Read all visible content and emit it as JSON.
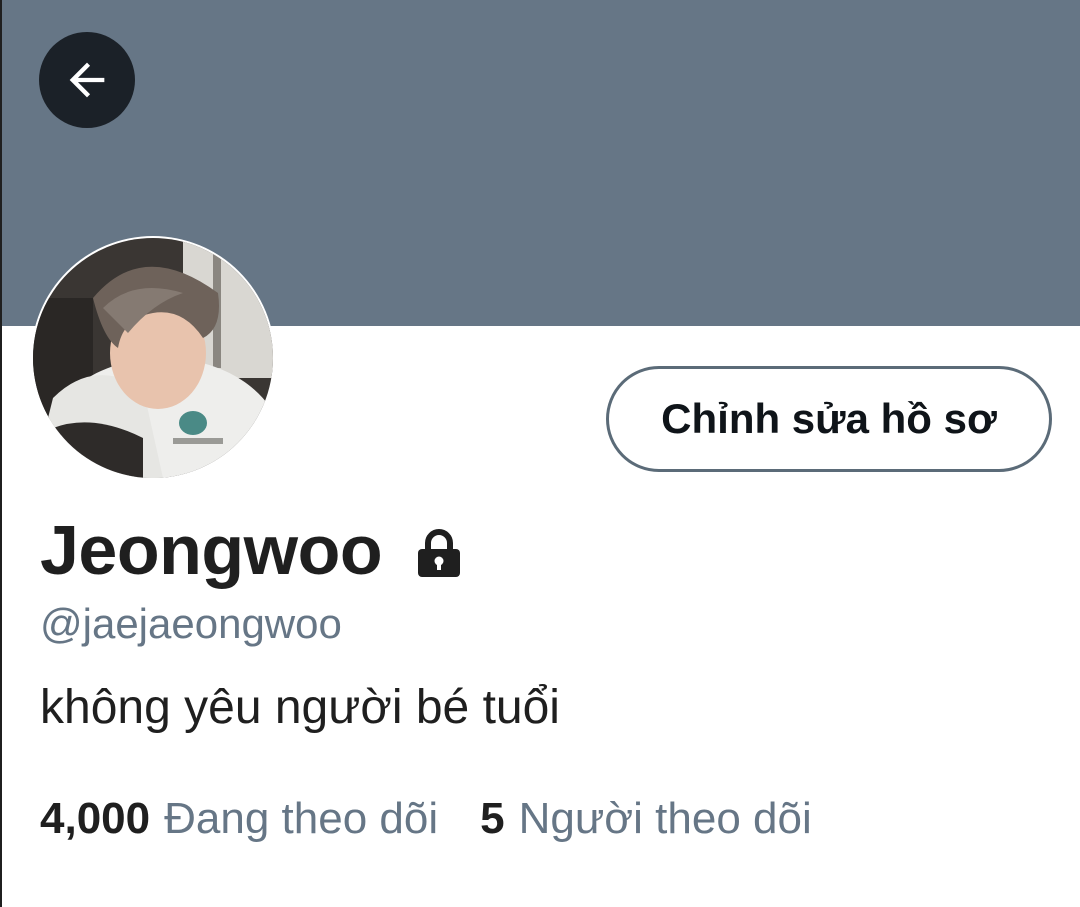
{
  "header": {
    "banner_color": "#667686",
    "back_icon": "arrow-left-icon"
  },
  "profile": {
    "avatar_icon": "avatar-photo",
    "edit_button_label": "Chỉnh sửa hồ sơ",
    "display_name": "Jeongwoo",
    "protected_icon": "lock-icon",
    "handle": "@jaejaeongwoo",
    "bio": "không yêu người bé tuổi"
  },
  "stats": {
    "following_count": "4,000",
    "following_label": "Đang theo dõi",
    "followers_count": "5",
    "followers_label": "Người theo dõi"
  }
}
